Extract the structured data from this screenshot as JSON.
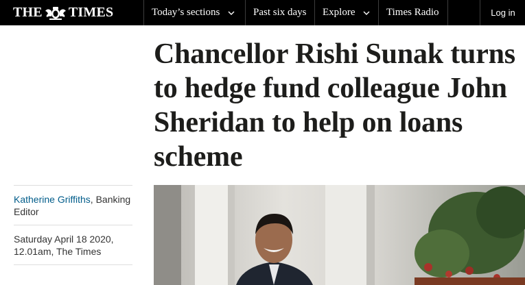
{
  "masthead": {
    "left_word": "THE",
    "right_word": "TIMES",
    "crest_icon": "royal-crest-icon"
  },
  "nav": {
    "items": [
      {
        "label": "Today’s sections",
        "has_dropdown": true
      },
      {
        "label": "Past six days",
        "has_dropdown": false
      },
      {
        "label": "Explore",
        "has_dropdown": true
      },
      {
        "label": "Times Radio",
        "has_dropdown": false
      }
    ],
    "login_label": "Log in"
  },
  "article": {
    "headline": "Chancellor Rishi Sunak turns to hedge fund colleague John Sheridan to help on loans scheme",
    "author": "Katherine Griffiths",
    "author_role": ", Banking Editor",
    "date": "Saturday April 18 2020,",
    "time_source": "12.01am, The Times",
    "photo": "man-smiling-outside-building-with-plants"
  },
  "colors": {
    "topbar": "#000000",
    "author_link": "#005c8a",
    "headline": "#1d1d1b"
  }
}
